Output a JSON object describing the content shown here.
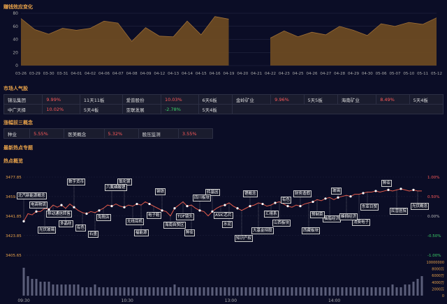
{
  "sections": {
    "profit_effect": "赚钱效应变化",
    "market_popularity": "市场人气股",
    "top3_concepts": "涨幅前三概念",
    "latest_hot": "最新热点专题",
    "hot_overview": "热点概览"
  },
  "chart_data": [
    {
      "type": "area",
      "title": "赚钱效应变化",
      "x": [
        "03-26",
        "03-29",
        "03-30",
        "03-31",
        "04-01",
        "04-02",
        "04-06",
        "04-07",
        "04-08",
        "04-09",
        "04-12",
        "04-13",
        "04-14",
        "04-15",
        "04-16",
        "04-19",
        "04-20",
        "04-21",
        "04-22",
        "04-23",
        "04-25",
        "04-26",
        "04-27",
        "04-28",
        "04-29",
        "04-30",
        "05-06",
        "05-07",
        "05-10",
        "05-11",
        "05-12"
      ],
      "values": [
        72,
        55,
        48,
        57,
        54,
        57,
        68,
        65,
        37,
        58,
        45,
        44,
        68,
        47,
        75,
        71,
        null,
        null,
        42,
        53,
        44,
        51,
        47,
        60,
        54,
        46,
        64,
        60,
        66,
        63,
        73
      ],
      "ylim": [
        0,
        80
      ],
      "yticks": [
        0,
        20,
        40,
        60,
        80
      ],
      "fill_color": "#6b4a22",
      "line_color": "#a07036"
    },
    {
      "type": "line",
      "title": "热点概览",
      "x_ticks": [
        "09:30",
        "10:30",
        "13:00",
        "14:00"
      ],
      "y_left_ticks": [
        3405.65,
        3423.85,
        3441.85,
        3459.85,
        3477.85
      ],
      "y_right_ticks": [
        "1.00%",
        "0.50%",
        "0.00%",
        "-0.50%",
        "-1.00%"
      ],
      "ylim": [
        3405.65,
        3477.85
      ],
      "volume_ticks": [
        "10000000",
        "8000万",
        "6000万",
        "4000万",
        "2000万",
        "0"
      ],
      "line_color": "#e35a4a",
      "values": [
        3437,
        3444,
        3443,
        3446,
        3446,
        3449,
        3448,
        3452,
        3450,
        3452,
        3449,
        3453,
        3450,
        3447,
        3445,
        3444,
        3446,
        3445,
        3447,
        3449,
        3452,
        3451,
        3453,
        3451,
        3450,
        3452,
        3451,
        3453,
        3452,
        3455,
        3453,
        3451,
        3449,
        3447,
        3446,
        3442,
        3449,
        3452,
        3455,
        3451,
        3452,
        3449,
        3447,
        3446,
        3442,
        3446,
        3449,
        3451,
        3452,
        3454,
        3451,
        3449,
        3447,
        3449,
        3451,
        3452,
        3454,
        3453,
        3451,
        3452,
        3454,
        3455,
        3453,
        3451,
        3450,
        3452,
        3451,
        3453,
        3454,
        3455,
        3457,
        3456,
        3458,
        3459,
        3457,
        3459,
        3460,
        3461,
        3460,
        3462,
        3462,
        3463,
        3464,
        3464,
        3465,
        3464,
        3465,
        3466,
        3465,
        3466,
        3467,
        3466,
        3465,
        3466,
        3465,
        3465
      ],
      "volume": [
        10,
        7,
        6,
        6,
        5,
        5,
        5,
        4,
        4,
        4,
        4,
        4,
        4,
        4,
        3,
        3,
        3,
        4,
        3,
        3,
        3,
        3,
        3,
        3,
        3,
        3,
        3,
        3,
        3,
        3,
        3,
        3,
        3,
        3,
        3,
        3,
        4,
        3,
        3,
        3,
        3,
        3,
        3,
        3,
        3,
        3,
        3,
        3,
        3,
        3,
        3,
        3,
        3,
        3,
        3,
        3,
        3,
        3,
        3,
        3,
        3,
        3,
        3,
        3,
        3,
        3,
        3,
        3,
        3,
        3,
        3,
        3,
        3,
        3,
        3,
        3,
        3,
        3,
        3,
        3,
        3,
        3,
        3,
        3,
        3,
        3,
        3,
        3,
        4,
        3,
        3,
        4,
        4,
        5,
        6,
        7
      ]
    }
  ],
  "popular_stocks": [
    [
      {
        "name": "锦泓集团",
        "pct": "9.99%",
        "boards": "11天11板"
      },
      {
        "name": "爱普股份",
        "pct": "10.03%",
        "boards": "6天6板"
      },
      {
        "name": "金岭矿业",
        "pct": "9.96%",
        "boards": "5天5板"
      },
      {
        "name": "海南矿业",
        "pct": "8.49%",
        "boards": "5天4板"
      }
    ],
    [
      {
        "name": "中广天择",
        "pct": "10.02%",
        "boards": "5天4板"
      },
      {
        "name": "亚联发展",
        "pct": "-2.78%",
        "boards": "5天4板"
      }
    ]
  ],
  "top_concepts": [
    {
      "name": "种业",
      "pct": "5.55%"
    },
    {
      "name": "医美概念",
      "pct": "5.32%"
    },
    {
      "name": "股压监测",
      "pct": "3.55%"
    }
  ],
  "hot_tags": [
    "电商物流",
    "多晶硅",
    "石墨",
    "氯化镁",
    "电子鞋",
    "TOF镜头",
    "转基因",
    "知识产权",
    "汇禧系",
    "财务造假",
    "抽脂经济",
    "消费电子",
    "种业",
    "光伏概念",
    "光伏玻璃",
    "数字货币",
    "免税店",
    "无线耳机",
    "钢铁",
    "种业",
    "ASIC芯片",
    "锂概念",
    "山西板块",
    "西藏板块",
    "玻璃",
    "东亚日贸",
    "民营医院",
    "北汽新能源概念",
    "移动通信转售",
    "有色",
    "六氟磷酸锂",
    "福能源",
    "海南自贸区",
    "四川板块",
    "水泥",
    "大基金持股",
    "有色",
    "预制菜",
    "蜂拥经济"
  ]
}
